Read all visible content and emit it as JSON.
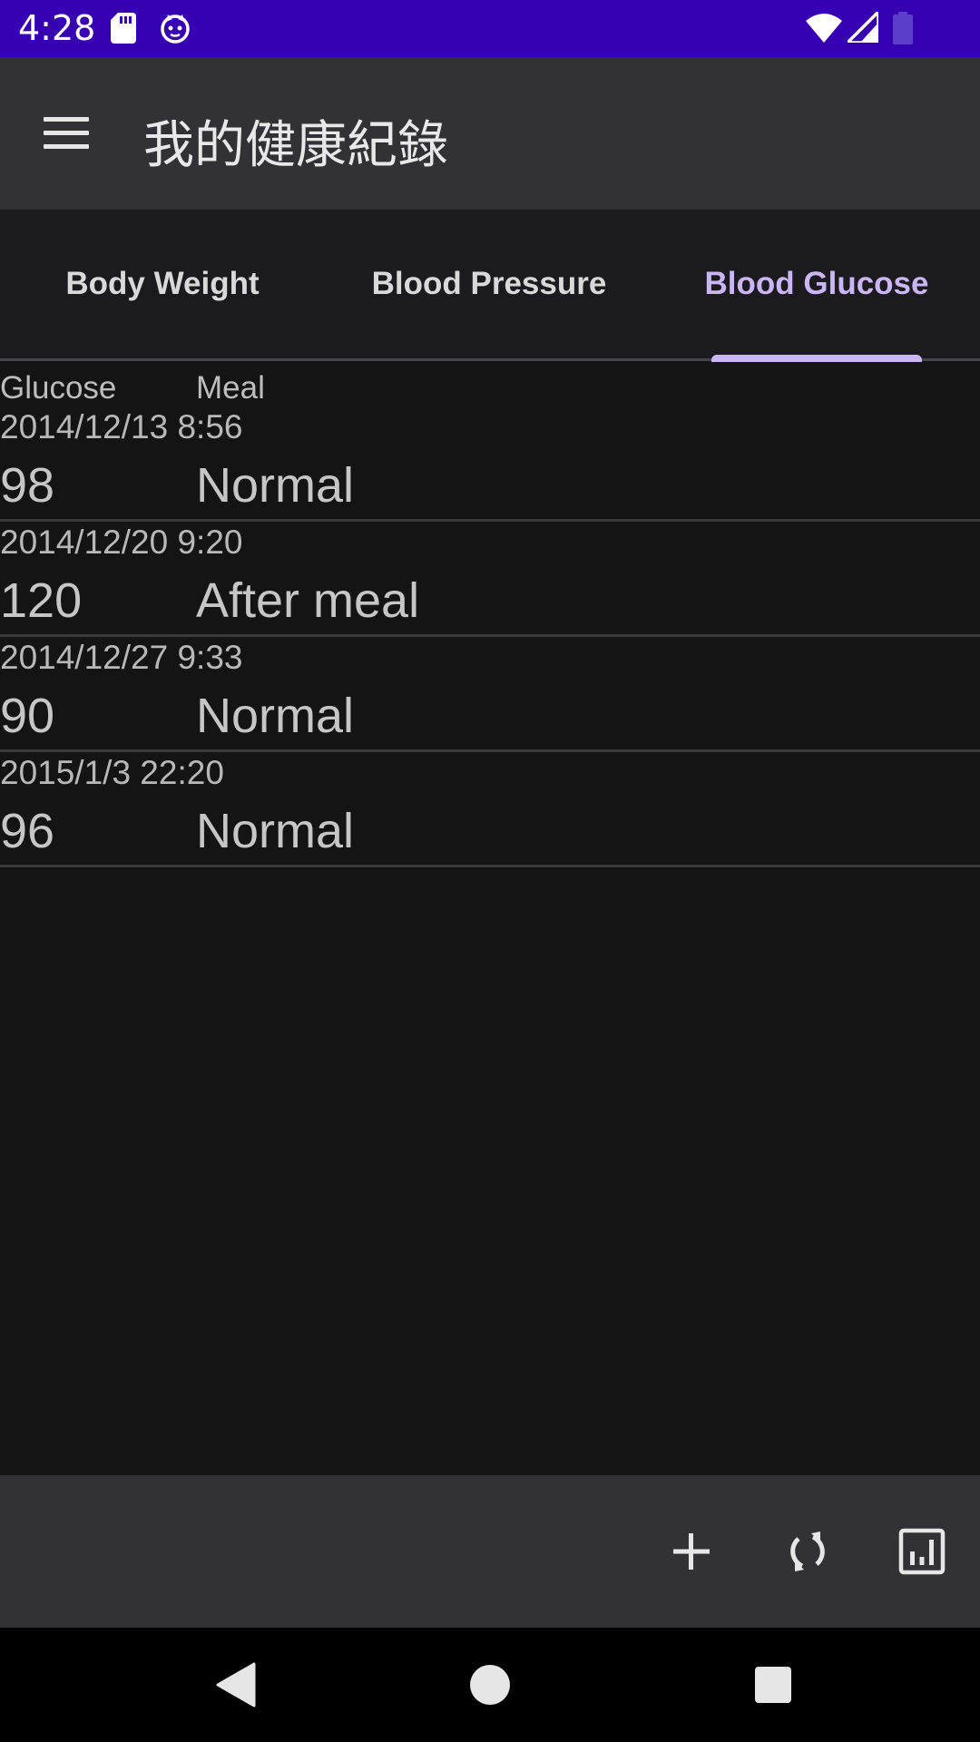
{
  "status_bar": {
    "time": "4:28",
    "icons": [
      "sd-card-icon",
      "cat-icon",
      "wifi-icon",
      "cellular-signal-icon",
      "battery-icon"
    ]
  },
  "app_bar": {
    "title": "我的健康紀錄",
    "menu_icon": "menu-icon"
  },
  "tabs": [
    {
      "label": "Body Weight",
      "selected": false
    },
    {
      "label": "Blood Pressure",
      "selected": false
    },
    {
      "label": "Blood Glucose",
      "selected": true
    }
  ],
  "list": {
    "headers": {
      "glucose": "Glucose",
      "meal": "Meal"
    },
    "records": [
      {
        "date": "2014/12/13 8:56",
        "glucose": "98",
        "meal": "Normal"
      },
      {
        "date": "2014/12/20 9:20",
        "glucose": "120",
        "meal": "After meal"
      },
      {
        "date": "2014/12/27 9:33",
        "glucose": "90",
        "meal": "Normal"
      },
      {
        "date": "2015/1/3 22:20",
        "glucose": "96",
        "meal": "Normal"
      }
    ]
  },
  "toolbar": {
    "icons": [
      "add-icon",
      "sync-icon",
      "chart-icon"
    ]
  },
  "nav_bar": {
    "icons": [
      "back-icon",
      "home-icon",
      "recents-icon"
    ]
  },
  "colors": {
    "status_bar": "#3700b3",
    "app_bar": "#323136",
    "accent": "#cbb6f5",
    "background": "#141414"
  }
}
